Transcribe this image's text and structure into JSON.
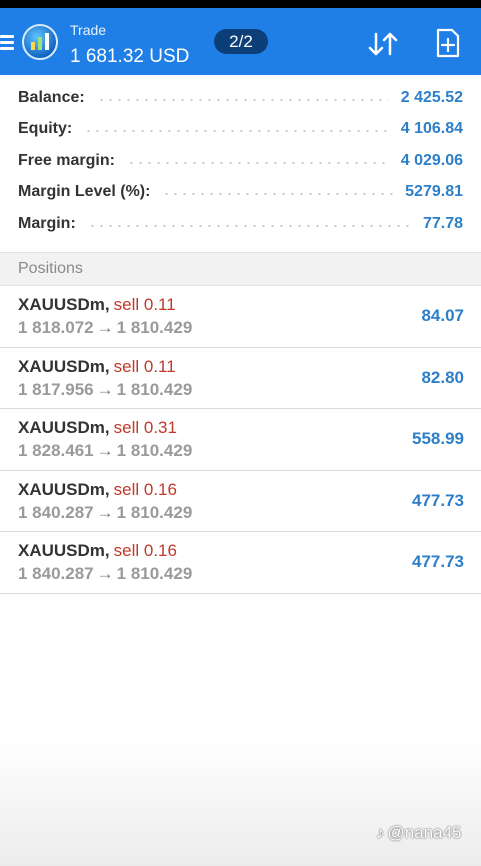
{
  "header": {
    "title_label": "Trade",
    "balance_display": "1 681.32 USD",
    "page_indicator": "2/2"
  },
  "summary": [
    {
      "label": "Balance:",
      "value": "2 425.52"
    },
    {
      "label": "Equity:",
      "value": "4 106.84"
    },
    {
      "label": "Free margin:",
      "value": "4 029.06"
    },
    {
      "label": "Margin Level (%):",
      "value": "5279.81"
    },
    {
      "label": "Margin:",
      "value": "77.78"
    }
  ],
  "positions_header": "Positions",
  "positions": [
    {
      "symbol": "XAUUSDm",
      "side": "sell 0.11",
      "open_price": "1 818.072",
      "current_price": "1 810.429",
      "profit": "84.07"
    },
    {
      "symbol": "XAUUSDm",
      "side": "sell 0.11",
      "open_price": "1 817.956",
      "current_price": "1 810.429",
      "profit": "82.80"
    },
    {
      "symbol": "XAUUSDm",
      "side": "sell 0.31",
      "open_price": "1 828.461",
      "current_price": "1 810.429",
      "profit": "558.99"
    },
    {
      "symbol": "XAUUSDm",
      "side": "sell 0.16",
      "open_price": "1 840.287",
      "current_price": "1 810.429",
      "profit": "477.73"
    },
    {
      "symbol": "XAUUSDm",
      "side": "sell 0.16",
      "open_price": "1 840.287",
      "current_price": "1 810.429",
      "profit": "477.73"
    }
  ],
  "watermark": "@nana45",
  "colors": {
    "appbar": "#1f7fe6",
    "value_blue": "#2d7fc8",
    "sell_red": "#c0392b"
  }
}
